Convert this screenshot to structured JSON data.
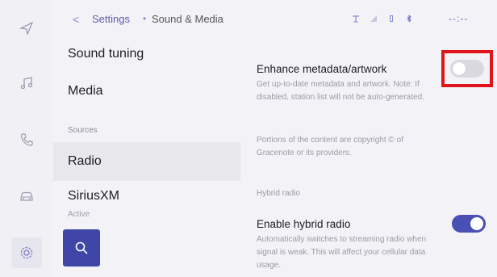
{
  "topbar": {
    "back_glyph": "<",
    "breadcrumb_parent": "Settings",
    "breadcrumb_separator": "•",
    "breadcrumb_current": "Sound & Media",
    "time": "--:--",
    "status_icons": [
      "signal-icon",
      "wifi-icon",
      "battery-icon",
      "bluetooth-icon"
    ]
  },
  "rail": {
    "items": [
      {
        "icon": "navigation-icon"
      },
      {
        "icon": "music-note-icon"
      },
      {
        "icon": "phone-icon"
      },
      {
        "icon": "car-icon"
      },
      {
        "icon": "settings-icon",
        "active": true
      }
    ]
  },
  "menu": {
    "items": [
      {
        "label": "Sound tuning"
      },
      {
        "label": "Media"
      },
      {
        "label": "Radio",
        "selected": true
      },
      {
        "label": "SiriusXM",
        "sublabel": "Active"
      }
    ],
    "section_label": "Sources",
    "search_icon": "search-icon"
  },
  "content": {
    "metadata": {
      "title": "Enhance metadata/artwork",
      "description": "Get up-to-date metadata and artwork. Note: If disabled, station list will not be auto-generated.",
      "enabled": false
    },
    "copyright": "Portions of the content are copyright © of Gracenote or its providers.",
    "hybrid_group_label": "Hybrid radio",
    "hybrid": {
      "title": "Enable hybrid radio",
      "description": "Automatically switches to streaming radio when signal is weak. This will affect your cellular data usage.",
      "enabled": true
    }
  },
  "colors": {
    "accent": "#4a4fb3",
    "highlight": "#e0141b",
    "search_button": "#3f46a8"
  }
}
